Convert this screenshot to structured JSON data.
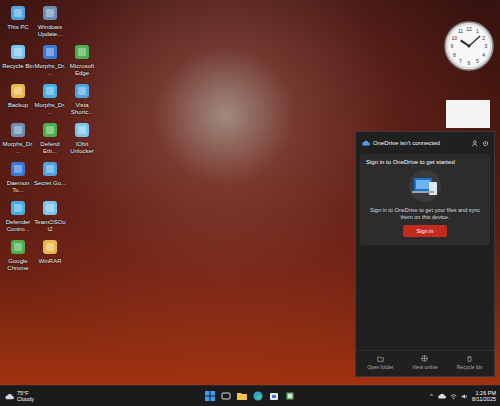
{
  "desktop": {
    "columns": [
      [
        {
          "label": "This PC"
        },
        {
          "label": "Recycle Bin"
        },
        {
          "label": "Backup"
        },
        {
          "label": "Morphs_Dr..."
        },
        {
          "label": "Daemon To..."
        },
        {
          "label": "Defender Contro..."
        },
        {
          "label": "Google Chrome"
        }
      ],
      [
        {
          "label": "Windows Update..."
        },
        {
          "label": "Morphs_Dr..."
        },
        {
          "label": "Morphs_Dr..."
        },
        {
          "label": "Defend Eth..."
        },
        {
          "label": "Secret Go..."
        },
        {
          "label": "TeamOSOut2"
        },
        {
          "label": "WinRAR"
        }
      ],
      [
        {
          "label": "Microsoft Edge"
        },
        {
          "label": "Vista Shortc..."
        },
        {
          "label": "IObit Unlocker"
        }
      ]
    ]
  },
  "clock": {
    "numbers": [
      "12",
      "1",
      "2",
      "3",
      "4",
      "5",
      "6",
      "7",
      "8",
      "9",
      "10",
      "11"
    ],
    "hour": 10,
    "minute": 8
  },
  "onedrive": {
    "title": "OneDrive isn't connected",
    "heading": "Sign in to OneDrive to get started",
    "message": "Sign in to OneDrive to get your files and sync them on this device.",
    "button": "Sign in",
    "actions": [
      "Open folder",
      "View online",
      "Recycle bin"
    ]
  },
  "taskbar": {
    "weather": {
      "temperature": "75°F",
      "condition": "Cloudy"
    },
    "chevron": "^",
    "time": "1:26 PM",
    "date": "8/11/2025"
  }
}
